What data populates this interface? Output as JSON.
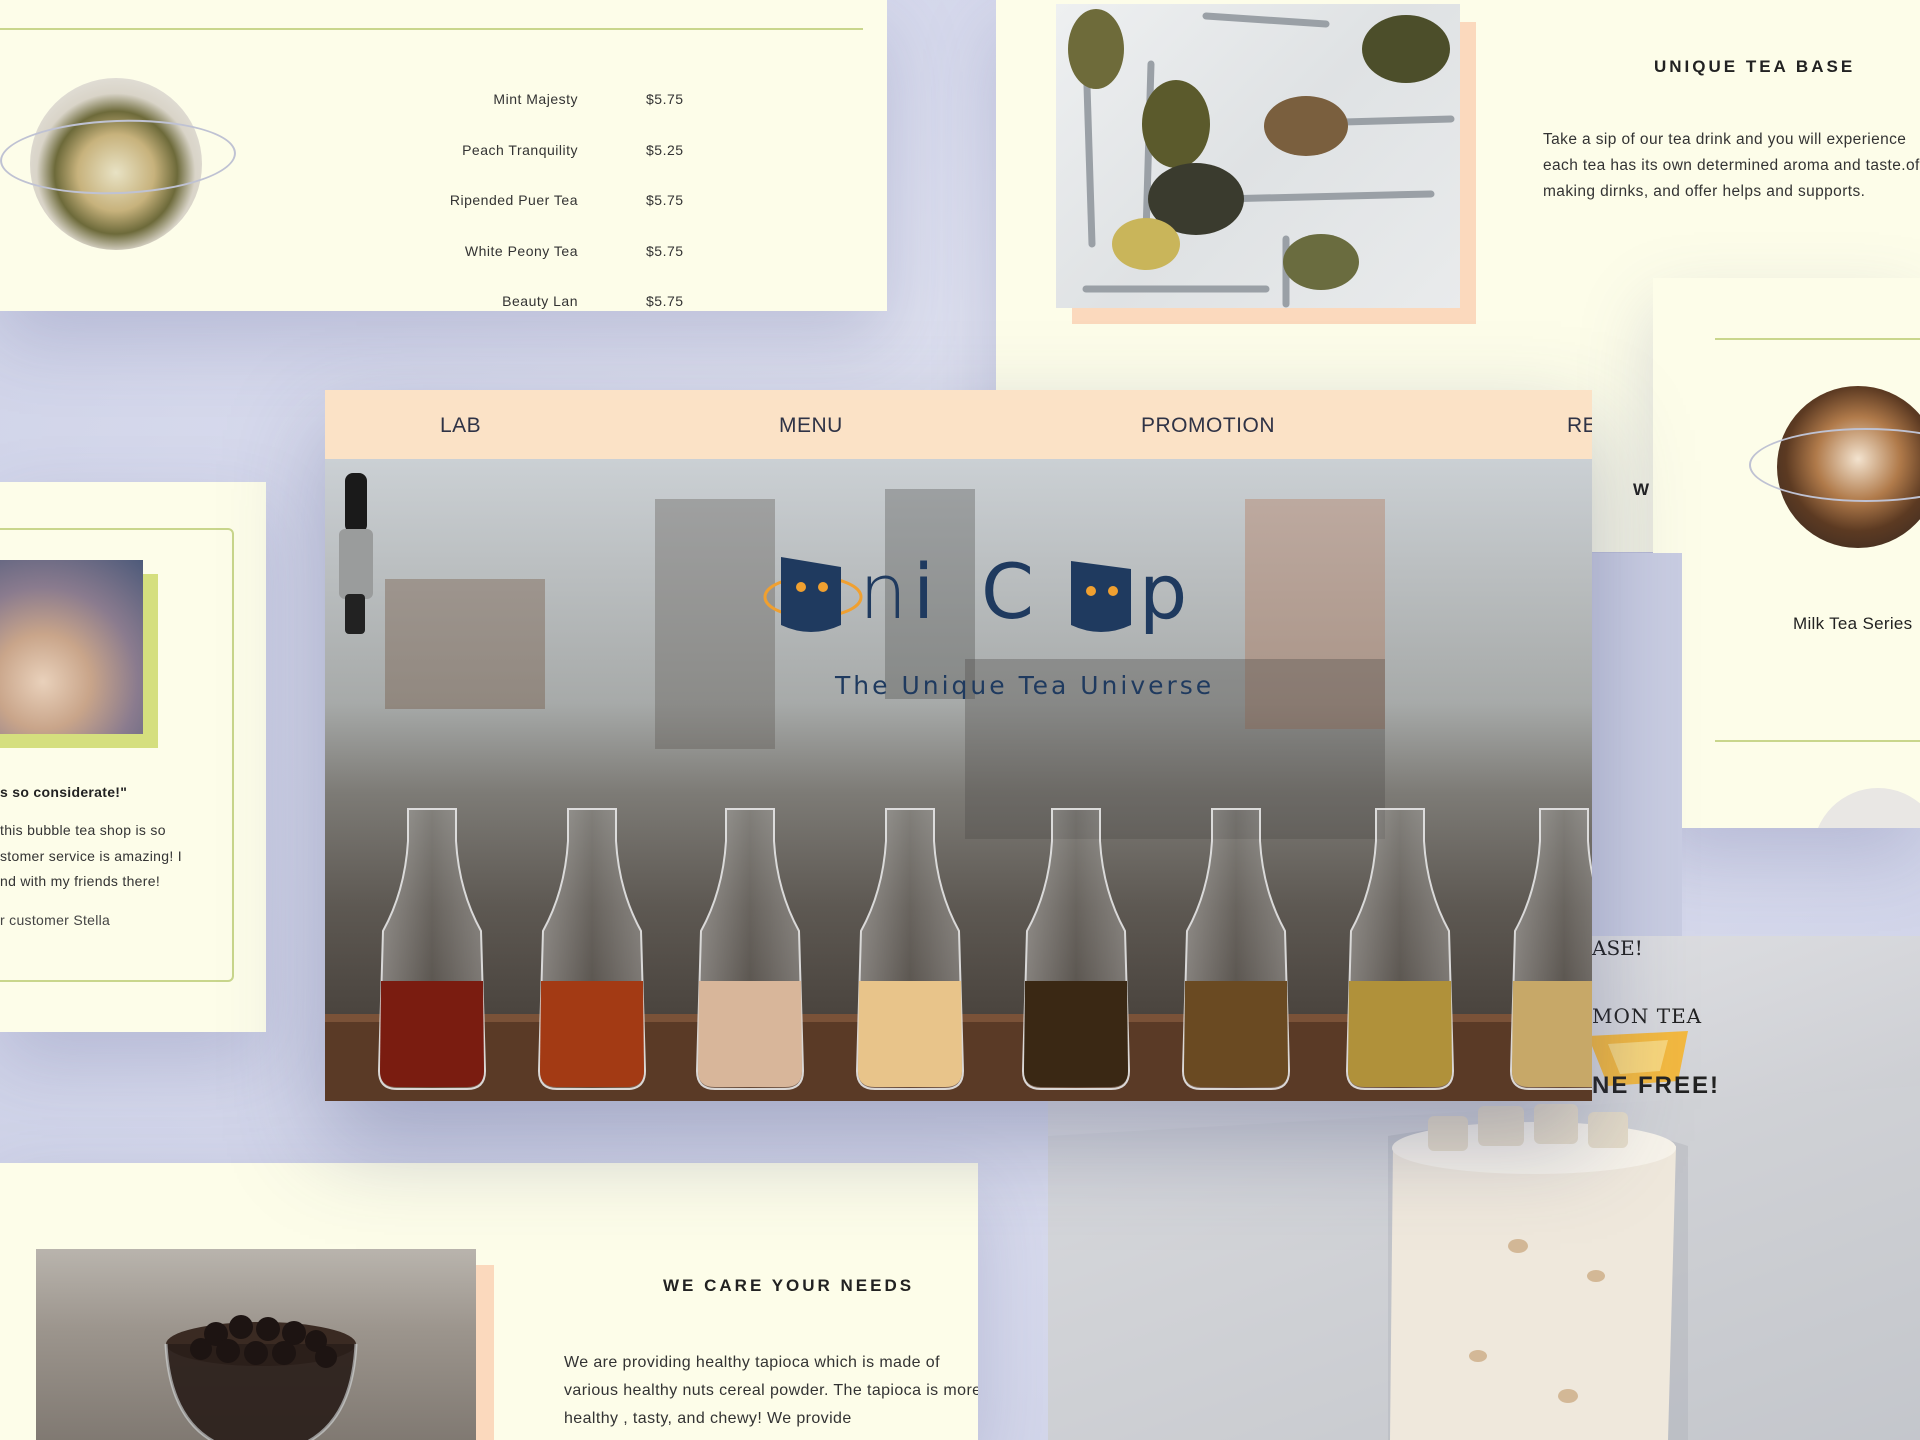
{
  "menu_card": {
    "items": [
      {
        "name": "Mint Majesty",
        "price": "$5.75"
      },
      {
        "name": "Peach Tranquility",
        "price": "$5.25"
      },
      {
        "name": "Ripended Puer Tea",
        "price": "$5.75"
      },
      {
        "name": "White Peony Tea",
        "price": "$5.75"
      },
      {
        "name": "Beauty Lan",
        "price": "$5.75"
      }
    ]
  },
  "tea_base_card": {
    "title": "UNIQUE TEA BASE",
    "body": "Take a sip of our tea drink and you will experience each tea has its own determined aroma and taste.of making dirnks, and offer helps and supports."
  },
  "milk_card": {
    "label": "Milk Tea Series",
    "partial_text": "W"
  },
  "review_card": {
    "quote": "s so considerate!\"",
    "lines": [
      "this bubble tea shop is so",
      "stomer service is amazing! I",
      "nd with my friends there!"
    ],
    "author": "r customer Stella"
  },
  "care_card": {
    "title": "WE CARE YOUR NEEDS",
    "body": "We are providing healthy tapioca which is made of various healthy nuts cereal powder. The tapioca is more healthy , tasty, and chewy! We provide"
  },
  "promo_card": {
    "line1": "ASE!",
    "line2": "MON TEA",
    "line3": "NE FREE!"
  },
  "main_card": {
    "nav": [
      "LAB",
      "MENU",
      "PROMOTION",
      "RE"
    ],
    "brand": "nic p",
    "brand_parts": {
      "a": "n",
      "b": "i",
      "c": "C",
      "d": "p"
    },
    "tagline": "The Unique Tea Universe"
  },
  "colors": {
    "card_bg": "#fdfde9",
    "nav_bg": "#fbe2c6",
    "accent_green": "#c9d68c",
    "accent_peach": "#fbd9bd",
    "brand_navy": "#1f3a5f",
    "brand_orange": "#f0a030"
  }
}
